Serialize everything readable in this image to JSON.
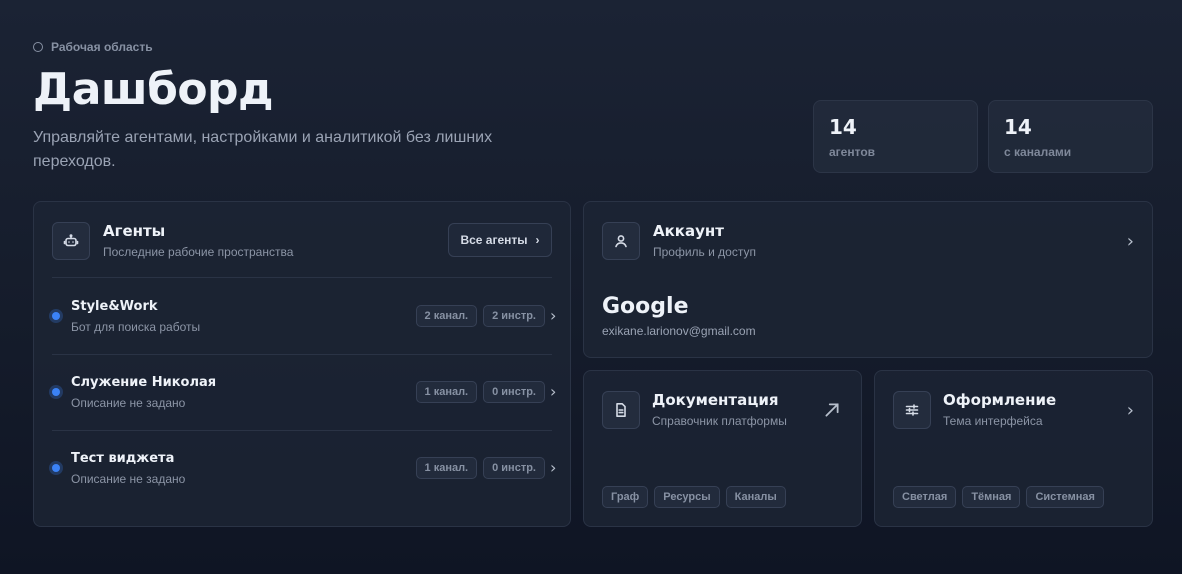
{
  "breadcrumb": "Рабочая область",
  "title": "Дашборд",
  "subtitle": "Управляйте агентами, настройками и аналитикой без лишних переходов.",
  "stats": [
    {
      "value": "14",
      "label": "агентов"
    },
    {
      "value": "14",
      "label": "с каналами"
    }
  ],
  "agents": {
    "title": "Агенты",
    "subtitle": "Последние рабочие пространства",
    "all_button": "Все агенты",
    "icon": "bot-icon",
    "items": [
      {
        "name": "Style&Work",
        "desc": "Бот для поиска работы",
        "channels": "2 канал.",
        "tools": "2 инстр."
      },
      {
        "name": "Служение Николая",
        "desc": "Описание не задано",
        "channels": "1 канал.",
        "tools": "0 инстр."
      },
      {
        "name": "Тест виджета",
        "desc": "Описание не задано",
        "channels": "1 канал.",
        "tools": "0 инстр."
      }
    ]
  },
  "account": {
    "title": "Аккаунт",
    "subtitle": "Профиль и доступ",
    "provider": "Google",
    "email": "exikane.larionov@gmail.com",
    "icon": "user-icon"
  },
  "docs": {
    "title": "Документация",
    "subtitle": "Справочник платформы",
    "tags": [
      "Граф",
      "Ресурсы",
      "Каналы"
    ],
    "icon": "document-icon"
  },
  "appearance": {
    "title": "Оформление",
    "subtitle": "Тема интерфейса",
    "tags": [
      "Светлая",
      "Тёмная",
      "Системная"
    ],
    "icon": "sliders-icon"
  },
  "colors": {
    "accent": "#3b82f6",
    "background": "#151c2b",
    "card": "#1c2434"
  }
}
